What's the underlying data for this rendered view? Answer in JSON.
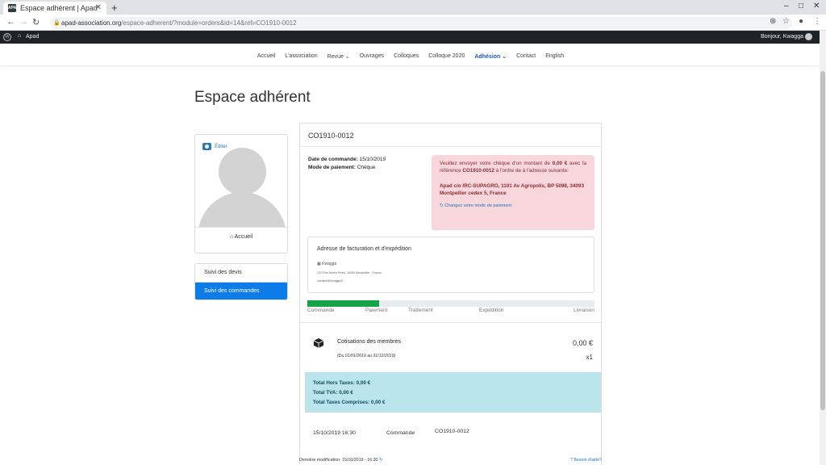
{
  "browser": {
    "tab_title": "Espace adhérent | Apad",
    "favicon_text": "APAD",
    "url_host": "apad-association.org",
    "url_path": "/espace-adherent/?module=orders&id=14&ref=CO1910-0012"
  },
  "wpbar": {
    "site_name": "Apad",
    "greeting": "Bonjour, Kwagga"
  },
  "nav": {
    "items": [
      "Accueil",
      "L'association",
      "Revue ⌄",
      "Ouvrages",
      "Colloques",
      "Colloque 2020",
      "Adhésion ⌄",
      "Contact",
      "English"
    ],
    "active_index": 6
  },
  "page": {
    "title": "Espace adhérent"
  },
  "profile": {
    "edit_label": "Éditer",
    "home_label": "Accueil"
  },
  "sidemenu": {
    "items": [
      "Suivi des devis",
      "Suivi des commandes"
    ],
    "active_index": 1
  },
  "order": {
    "reference": "CO1910-0012",
    "date_label": "Date de commande:",
    "date_value": "15/10/2019",
    "payment_label": "Mode de paiement:",
    "payment_value": "Chèque",
    "alert_prefix": "Veuillez envoyer votre chèque d'un montant de",
    "alert_amount": "0,00 €",
    "alert_mid": "avec la référence",
    "alert_ref": "CO1910-0012",
    "alert_suffix": "à l'ordre de à l'adresse suivante:",
    "alert_address": "Apad c/o IRC-SUPAGRO, 1101 Av Agropolis, BP 5098, 34093 Montpellier cedex 5, France",
    "alert_change": "Changez votre mode de paiement",
    "billing_title": "Adresse de facturation et d'expédition",
    "billing_name": "Kwagga",
    "billing_address": "123 Rue Adrien Proby, 34090 Montpellier - France",
    "billing_email": "contact@kwagga.fr -",
    "progress": 0.25,
    "steps": [
      "Commande",
      "Paiement",
      "Traitement",
      "Expédition",
      "Livraison"
    ],
    "item_name": "Cotisations des membres",
    "item_period": "(Du 01/01/2019 au 31/12/2019)",
    "item_price": "0,00 €",
    "item_qty": "x1",
    "total_ht": "Total Hors Taxes: 0,00 €",
    "total_tva": "Total TVA: 0,00 €",
    "total_ttc": "Total Taxes Comprises: 0,00 €",
    "history_date": "15/10/2019 16:30",
    "history_type": "Commande",
    "history_ref": "CO1910-0012"
  },
  "footer": {
    "last_modified": "Dernière modification: 15/10/2019 - 16:30",
    "help": "Besoin d'aide?"
  },
  "colors": {
    "accent": "#0d7ce8",
    "alert_bg": "#f8d7dc",
    "totals_bg": "#bbe5ec",
    "progress": "#16a34a",
    "wpbar": "#1d2327"
  }
}
